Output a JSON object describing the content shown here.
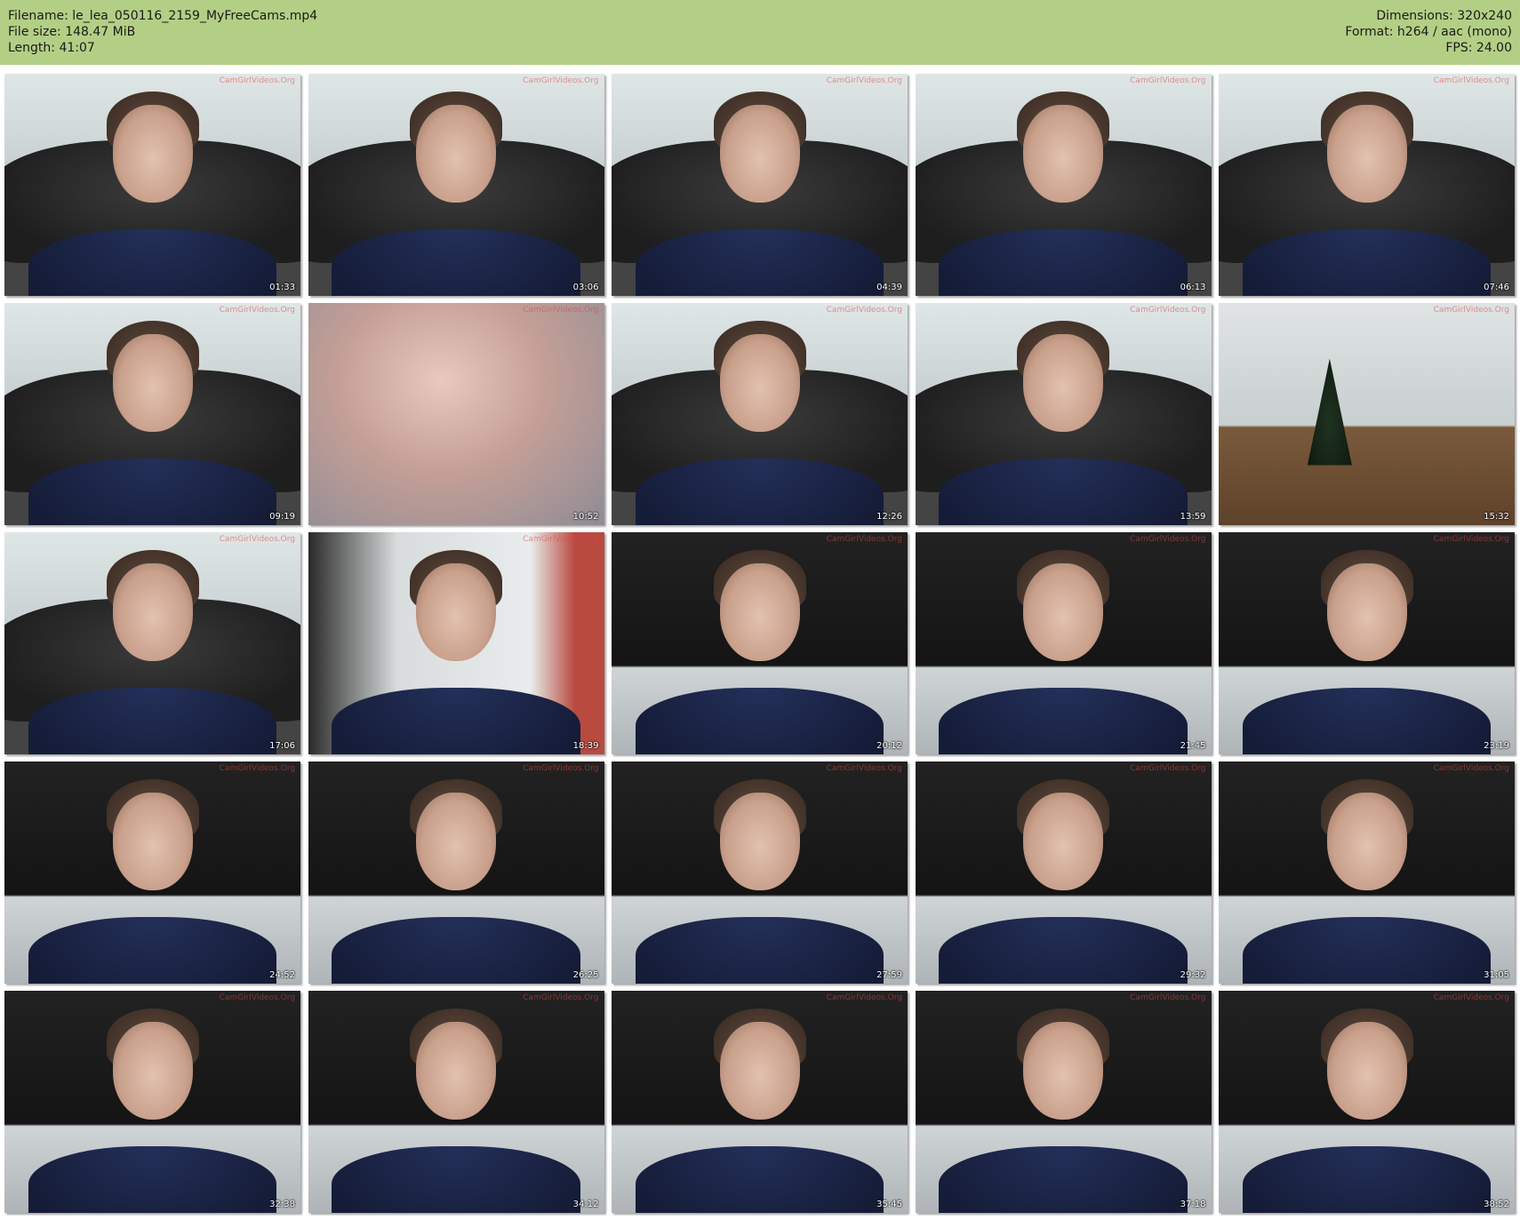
{
  "header": {
    "filename": "Filename: le_lea_050116_2159_MyFreeCams.mp4",
    "filesize": "File size: 148.47 MiB",
    "length": "Length: 41:07",
    "dimensions": "Dimensions: 320x240",
    "format": "Format: h264 / aac (mono)",
    "fps": "FPS: 24.00"
  },
  "watermark": "CamGirlVideos.Org",
  "thumbnails": [
    {
      "time": "01:33",
      "scene": "couch"
    },
    {
      "time": "03:06",
      "scene": "couch"
    },
    {
      "time": "04:39",
      "scene": "couch"
    },
    {
      "time": "06:13",
      "scene": "couch"
    },
    {
      "time": "07:46",
      "scene": "couch"
    },
    {
      "time": "09:19",
      "scene": "couch"
    },
    {
      "time": "10:52",
      "scene": "blur"
    },
    {
      "time": "12:26",
      "scene": "couch"
    },
    {
      "time": "13:59",
      "scene": "couch"
    },
    {
      "time": "15:32",
      "scene": "room"
    },
    {
      "time": "17:06",
      "scene": "couch"
    },
    {
      "time": "18:39",
      "scene": "eat"
    },
    {
      "time": "20:12",
      "scene": "bed"
    },
    {
      "time": "21:45",
      "scene": "bed"
    },
    {
      "time": "23:19",
      "scene": "bed"
    },
    {
      "time": "24:52",
      "scene": "bed"
    },
    {
      "time": "26:25",
      "scene": "bed"
    },
    {
      "time": "27:59",
      "scene": "bed"
    },
    {
      "time": "29:32",
      "scene": "bed"
    },
    {
      "time": "31:05",
      "scene": "bed"
    },
    {
      "time": "32:38",
      "scene": "bed"
    },
    {
      "time": "34:12",
      "scene": "bed"
    },
    {
      "time": "35:45",
      "scene": "bed"
    },
    {
      "time": "37:18",
      "scene": "bed"
    },
    {
      "time": "38:52",
      "scene": "bed"
    }
  ],
  "colors": {
    "header_bg": "#b3cf85",
    "page_bg": "#ffffff",
    "timestamp_text": "#ffffff",
    "watermark_text": "#dc4646"
  }
}
